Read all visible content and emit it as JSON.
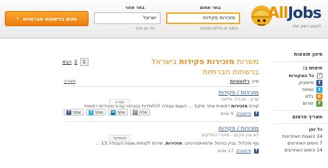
{
  "header": {
    "logo_text_all": "All",
    "logo_text_jobs": "Jobs",
    "logo_tagline": "להגיע רחוק יותר",
    "field_label": "בחר תחום",
    "field_value": "מזכירות פקידות",
    "field_hint": "הוסף או מילות מפתח",
    "area_label": "בחר אזור",
    "area_value": "ישראל",
    "area_hint": "עיר או אזור",
    "search_button": "חפש ברשתות חברתיות"
  },
  "sidebar": {
    "filter_title": "סינון תוצאות",
    "search_in": "חיפוש ב:",
    "all_sources": "כל המקורות",
    "sources": [
      {
        "label": "פייסבוק",
        "icon": "facebook-icon",
        "cls": "fb",
        "glyph": "f"
      },
      {
        "label": "טוויטר",
        "icon": "twitter-icon",
        "cls": "tw",
        "glyph": "t"
      },
      {
        "label": "בלוג",
        "icon": "blog-icon",
        "cls": "bl",
        "glyph": "B"
      },
      {
        "label": "פורום",
        "icon": "forum-icon",
        "cls": "fo",
        "glyph": "F"
      }
    ],
    "date_title": "תאריך פרסום",
    "times": [
      "כל זמן",
      "24 השעות האחרונות",
      "7 הימים האחרונים",
      "14 הימים האחרונים"
    ]
  },
  "main": {
    "title_prefix": "משרות ",
    "title_bold": "מזכירות פקידות",
    "title_suffix": " בישראל ברשתות חברתיות",
    "pager_current": "1",
    "pager_next_page": "2",
    "pager_next": "הבא",
    "sort_label": "מיין:",
    "sort_relevance": "רלוונטיות",
    "sort_date": "תאריך",
    "results": [
      {
        "title": "מזכירות / פקידות",
        "sub": "שרון - חבורה מלאה",
        "snippet_pre": "קורס ",
        "snippet_bold": "מזכירות",
        "snippet_post": " רפואית אתר מיקוד ... העצמ עבודה להלמידות ובוגרות קורס מזכירות רפואית",
        "source": "פייסבוק",
        "age": "9 שנים",
        "logo_label": "חברה",
        "shares": [
          "שתף",
          "שתף",
          "שתף",
          "שלח"
        ]
      },
      {
        "title": "מזכירות / פקידות",
        "sub": "לא צוין מקום - מזכרי החלקים",
        "snippet_pre": "נוף מיכלול: בניין בניהול אדמיניסטרטיבי, ",
        "snippet_bold": "מזכירות",
        "snippet_post": ", שירות לקוחות,שעות העבודה 13 ...",
        "source": "פייסבוק",
        "age": "17 שנים",
        "logo_label": "תעסוקה"
      }
    ]
  }
}
